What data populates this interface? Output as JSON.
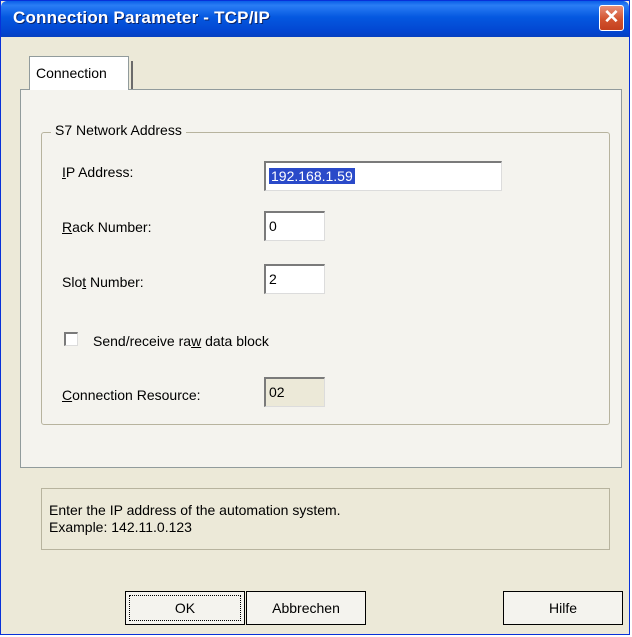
{
  "window": {
    "title": "Connection Parameter - TCP/IP"
  },
  "tabs": [
    {
      "label": "Connection"
    }
  ],
  "group": {
    "title": "S7 Network Address",
    "ip_label_u": "I",
    "ip_label_rest": "P Address:",
    "ip_value": "192.168.1.59",
    "rack_label_u": "R",
    "rack_label_rest": "ack Number:",
    "rack_value": "0",
    "slot_label_a": "Slo",
    "slot_label_u": "t",
    "slot_label_rest": " Number:",
    "slot_value": "2",
    "raw_label_a": "Send/receive ra",
    "raw_label_u": "w",
    "raw_label_rest": " data block",
    "raw_checked": false,
    "resource_label_u": "C",
    "resource_label_rest": "onnection Resource:",
    "resource_value": "02"
  },
  "help": {
    "line1": "Enter the IP address of the automation system.",
    "line2": "Example: 142.11.0.123"
  },
  "buttons": {
    "ok": "OK",
    "cancel": "Abbrechen",
    "help": "Hilfe"
  },
  "colors": {
    "titlebar": "#0458e0",
    "close": "#d2532f",
    "selection": "#2a4ac9",
    "dialog_bg": "#ece9d8"
  }
}
